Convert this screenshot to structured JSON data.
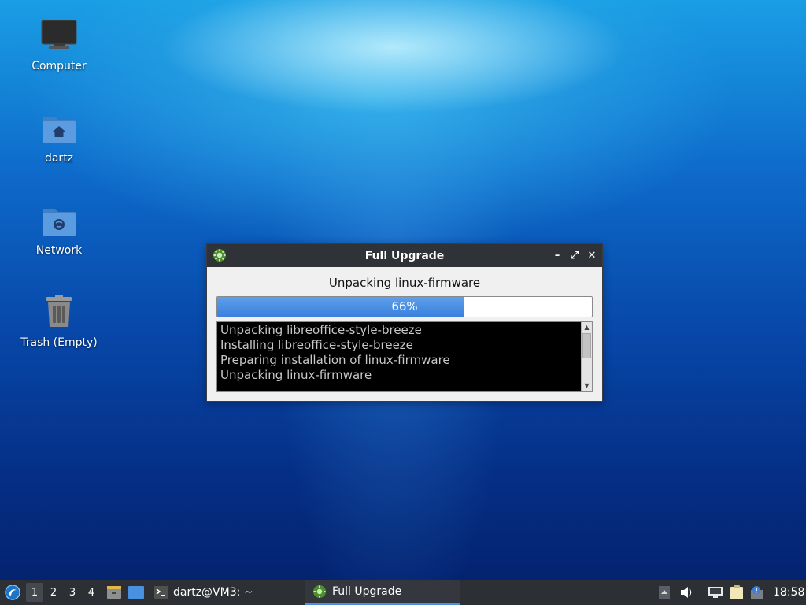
{
  "desktop": {
    "icons": [
      {
        "label": "Computer"
      },
      {
        "label": "dartz"
      },
      {
        "label": "Network"
      },
      {
        "label": "Trash (Empty)"
      }
    ]
  },
  "dialog": {
    "title": "Full Upgrade",
    "status": "Unpacking linux-firmware",
    "progress_percent": 66,
    "progress_label": "66%",
    "log_lines": [
      "Unpacking libreoffice-style-breeze",
      "Installing libreoffice-style-breeze",
      "Preparing installation of linux-firmware",
      "Unpacking linux-firmware"
    ],
    "controls": {
      "minimize": "–",
      "maximize": "⤢",
      "close": "✕"
    }
  },
  "taskbar": {
    "workspaces": [
      "1",
      "2",
      "3",
      "4"
    ],
    "active_workspace": "1",
    "tasks": [
      {
        "label": "dartz@VM3: ~",
        "icon": "terminal-icon"
      },
      {
        "label": "Full Upgrade",
        "icon": "gear-icon"
      }
    ],
    "clock": "18:58"
  },
  "colors": {
    "accent": "#3b80dc",
    "taskbar_bg": "#2c2f34",
    "titlebar_bg": "#2f3237"
  }
}
